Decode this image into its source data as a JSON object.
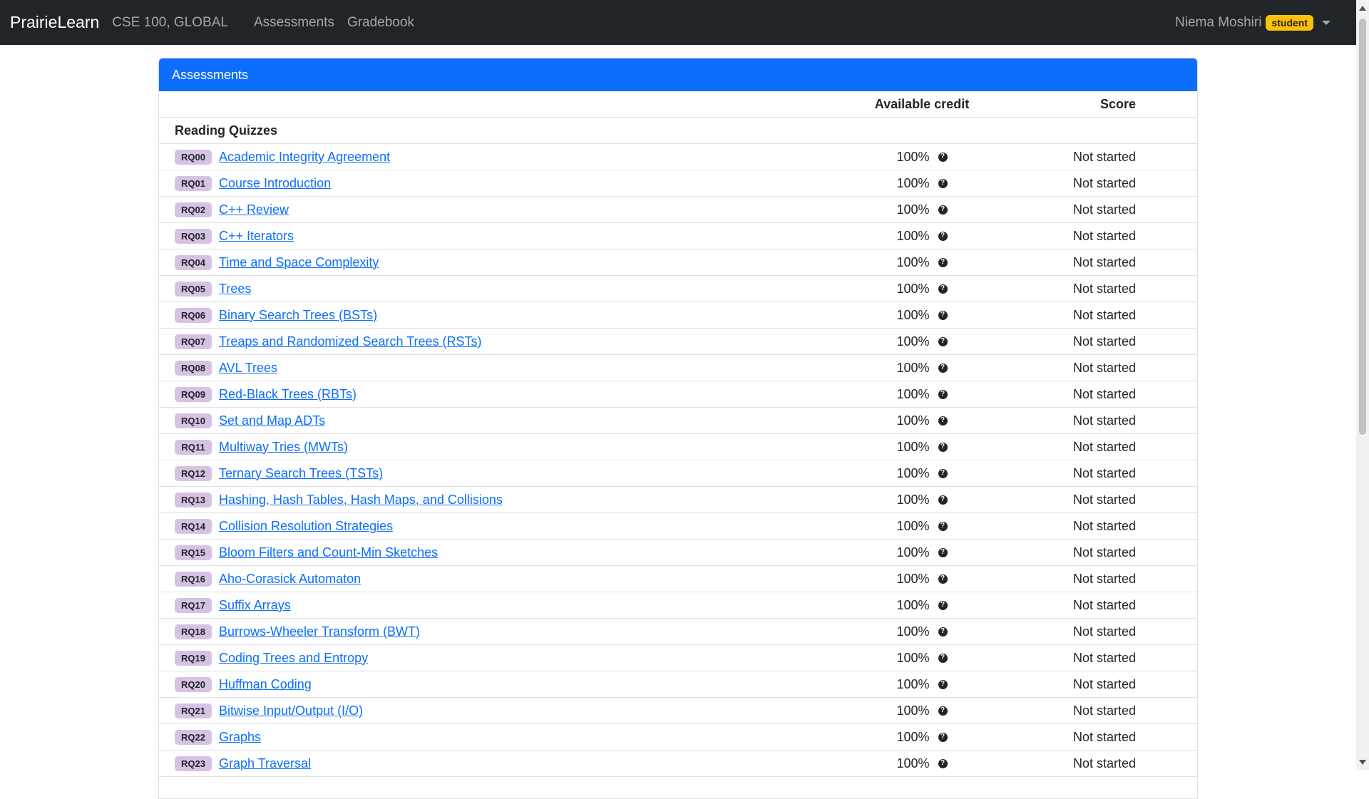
{
  "navbar": {
    "brand": "PrairieLearn",
    "course": "CSE 100, GLOBAL",
    "links": [
      "Assessments",
      "Gradebook"
    ],
    "user_name": "Niema Moshiri",
    "role_badge": "student"
  },
  "card": {
    "title": "Assessments",
    "columns": {
      "credit": "Available credit",
      "score": "Score"
    },
    "group": "Reading Quizzes",
    "rows": [
      {
        "badge": "RQ00",
        "title": "Academic Integrity Agreement",
        "credit": "100%",
        "score": "Not started"
      },
      {
        "badge": "RQ01",
        "title": "Course Introduction",
        "credit": "100%",
        "score": "Not started"
      },
      {
        "badge": "RQ02",
        "title": "C++ Review",
        "credit": "100%",
        "score": "Not started"
      },
      {
        "badge": "RQ03",
        "title": "C++ Iterators",
        "credit": "100%",
        "score": "Not started"
      },
      {
        "badge": "RQ04",
        "title": "Time and Space Complexity",
        "credit": "100%",
        "score": "Not started"
      },
      {
        "badge": "RQ05",
        "title": "Trees",
        "credit": "100%",
        "score": "Not started"
      },
      {
        "badge": "RQ06",
        "title": "Binary Search Trees (BSTs)",
        "credit": "100%",
        "score": "Not started"
      },
      {
        "badge": "RQ07",
        "title": "Treaps and Randomized Search Trees (RSTs)",
        "credit": "100%",
        "score": "Not started"
      },
      {
        "badge": "RQ08",
        "title": "AVL Trees",
        "credit": "100%",
        "score": "Not started"
      },
      {
        "badge": "RQ09",
        "title": "Red-Black Trees (RBTs)",
        "credit": "100%",
        "score": "Not started"
      },
      {
        "badge": "RQ10",
        "title": "Set and Map ADTs",
        "credit": "100%",
        "score": "Not started"
      },
      {
        "badge": "RQ11",
        "title": "Multiway Tries (MWTs)",
        "credit": "100%",
        "score": "Not started"
      },
      {
        "badge": "RQ12",
        "title": "Ternary Search Trees (TSTs)",
        "credit": "100%",
        "score": "Not started"
      },
      {
        "badge": "RQ13",
        "title": "Hashing, Hash Tables, Hash Maps, and Collisions",
        "credit": "100%",
        "score": "Not started"
      },
      {
        "badge": "RQ14",
        "title": "Collision Resolution Strategies",
        "credit": "100%",
        "score": "Not started"
      },
      {
        "badge": "RQ15",
        "title": "Bloom Filters and Count-Min Sketches",
        "credit": "100%",
        "score": "Not started"
      },
      {
        "badge": "RQ16",
        "title": "Aho-Corasick Automaton",
        "credit": "100%",
        "score": "Not started"
      },
      {
        "badge": "RQ17",
        "title": "Suffix Arrays",
        "credit": "100%",
        "score": "Not started"
      },
      {
        "badge": "RQ18",
        "title": "Burrows-Wheeler Transform (BWT)",
        "credit": "100%",
        "score": "Not started"
      },
      {
        "badge": "RQ19",
        "title": "Coding Trees and Entropy",
        "credit": "100%",
        "score": "Not started"
      },
      {
        "badge": "RQ20",
        "title": "Huffman Coding",
        "credit": "100%",
        "score": "Not started"
      },
      {
        "badge": "RQ21",
        "title": "Bitwise Input/Output (I/O)",
        "credit": "100%",
        "score": "Not started"
      },
      {
        "badge": "RQ22",
        "title": "Graphs",
        "credit": "100%",
        "score": "Not started"
      },
      {
        "badge": "RQ23",
        "title": "Graph Traversal",
        "credit": "100%",
        "score": "Not started"
      }
    ]
  }
}
